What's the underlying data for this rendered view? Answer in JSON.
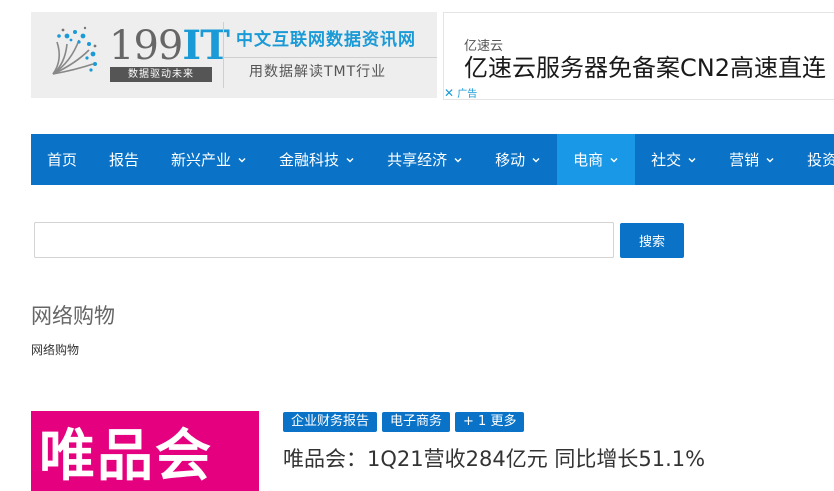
{
  "header": {
    "logo": {
      "number": "199",
      "it": "IT",
      "tagline": "数据驱动未来",
      "slogan_primary": "中文互联网数据资讯网",
      "slogan_secondary": "用数据解读TMT行业",
      "accent_color": "#1a9ad6"
    },
    "ad": {
      "brand": "亿速云",
      "headline": "亿速云服务器免备案CN2高速直连",
      "close_glyph": "✕",
      "label": "广告"
    }
  },
  "nav": {
    "background_color": "#0a73c8",
    "active_color": "#1a98e8",
    "items": [
      {
        "label": "首页",
        "dropdown": false
      },
      {
        "label": "报告",
        "dropdown": false
      },
      {
        "label": "新兴产业",
        "dropdown": true
      },
      {
        "label": "金融科技",
        "dropdown": true
      },
      {
        "label": "共享经济",
        "dropdown": true
      },
      {
        "label": "移动",
        "dropdown": true
      },
      {
        "label": "电商",
        "dropdown": true,
        "active": true
      },
      {
        "label": "社交",
        "dropdown": true
      },
      {
        "label": "营销",
        "dropdown": true
      },
      {
        "label": "投资",
        "dropdown": false
      }
    ]
  },
  "search": {
    "value": "",
    "placeholder": "",
    "button_label": "搜索"
  },
  "category": {
    "title": "网络购物",
    "breadcrumb": "网络购物"
  },
  "articles": [
    {
      "thumbnail_text": "唯品会",
      "thumbnail_color": "#e5007f",
      "tags": [
        "企业财务报告",
        "电子商务",
        "+ 1 更多"
      ],
      "title": "唯品会：1Q21营收284亿元 同比增长51.1%"
    }
  ]
}
